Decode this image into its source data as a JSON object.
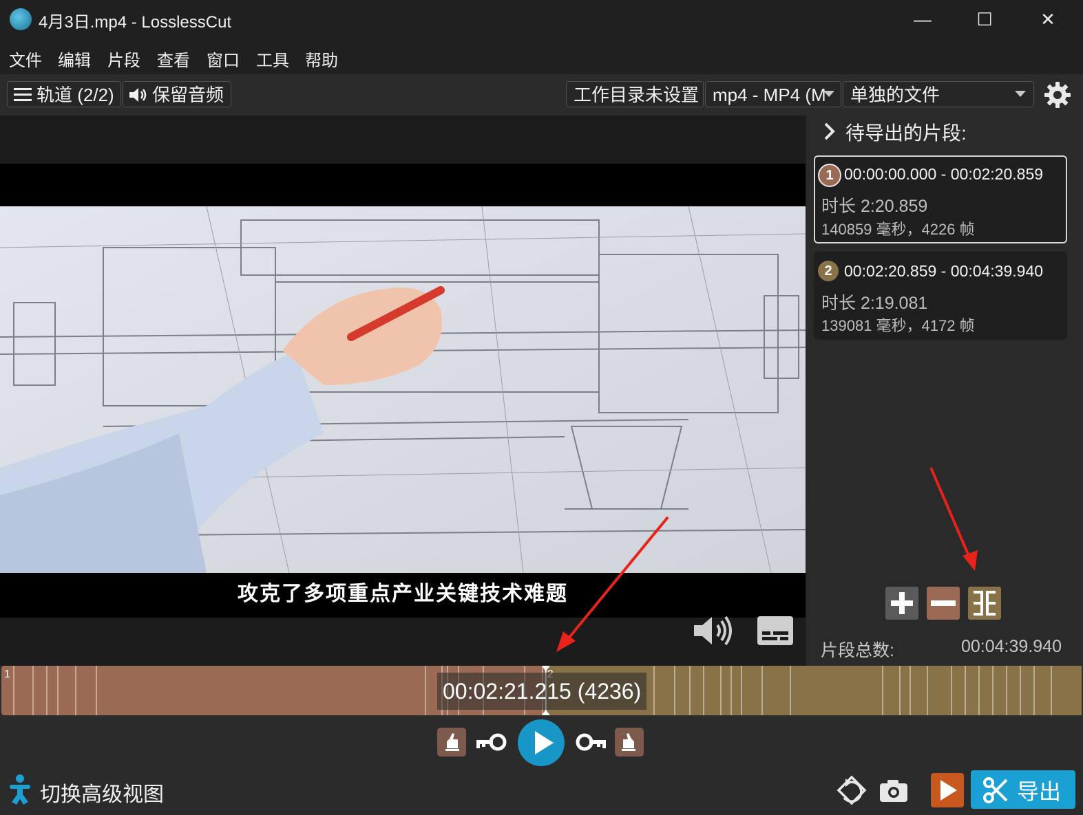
{
  "window": {
    "title": "4月3日.mp4 - LosslessCut",
    "minimize": "—",
    "maximize": "☐",
    "close": "✕"
  },
  "menu": [
    "文件",
    "编辑",
    "片段",
    "查看",
    "窗口",
    "工具",
    "帮助"
  ],
  "toolbar": {
    "tracks_label": "轨道 (2/2)",
    "audio_label": "保留音频",
    "workdir_label": "工作目录未设置",
    "format_label": "mp4 - MP4 (M",
    "output_mode_label": "单独的文件"
  },
  "video": {
    "subtitle": "攻克了多项重点产业关键技术难题"
  },
  "segments_panel": {
    "title": "待导出的片段:",
    "segments": [
      {
        "index": "1",
        "range": "00:00:00.000 - 00:02:20.859",
        "duration": "时长 2:20.859",
        "frames": "140859 毫秒，4226 帧",
        "color": "#9a6a55"
      },
      {
        "index": "2",
        "range": "00:02:20.859 - 00:04:39.940",
        "duration": "时长 2:19.081",
        "frames": "139081 毫秒，4172 帧",
        "color": "#8a7248"
      }
    ],
    "total_label": "片段总数:",
    "total_value": "00:04:39.940"
  },
  "timeline": {
    "current_time": "00:02:21.215 (4236)",
    "segment_markers": [
      "1",
      "2"
    ],
    "playhead_fraction": 0.504,
    "segment_split_fraction": 0.504
  },
  "bottom_bar": {
    "advanced_view_label": "切换高级视图",
    "export_label": "导出"
  },
  "colors": {
    "accent": "#1aa0d2",
    "segment1": "#9a6a55",
    "segment2": "#8a7248",
    "add_button": "#5a5a5a",
    "remove_button": "#9a6a55",
    "split_button": "#8a7248"
  },
  "icons": [
    "clapper-app-icon",
    "hamburger-icon",
    "speaker-icon",
    "chevron-down-icon",
    "gear-icon",
    "chevron-right-icon",
    "plus-icon",
    "minus-icon",
    "split-icon",
    "volume-icon",
    "subtitle-icon",
    "set-cut-start-icon",
    "prev-keyframe-icon",
    "play-icon",
    "next-keyframe-icon",
    "set-cut-end-icon",
    "accessibility-icon",
    "rotate-icon",
    "camera-icon",
    "preview-icon",
    "scissors-icon"
  ]
}
